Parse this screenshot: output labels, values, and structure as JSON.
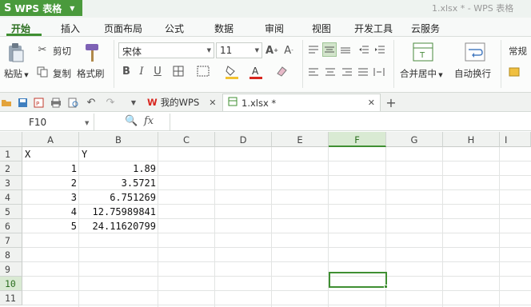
{
  "app": {
    "name": "WPS 表格",
    "logo": "S"
  },
  "window": {
    "title": "1.xlsx * - WPS 表格"
  },
  "ribbon_tabs": [
    "开始",
    "插入",
    "页面布局",
    "公式",
    "数据",
    "审阅",
    "视图",
    "开发工具",
    "云服务"
  ],
  "ribbon": {
    "paste": "粘贴",
    "cut": "剪切",
    "copy": "复制",
    "format_painter": "格式刷",
    "font_name": "宋体",
    "font_size": "11",
    "merge_center": "合并居中",
    "wrap_text": "自动换行",
    "normal": "常规"
  },
  "doc_tabs": {
    "home": "我的WPS",
    "file": "1.xlsx *"
  },
  "name_box": "F10",
  "formula_fx": "fx",
  "columns": [
    "A",
    "B",
    "C",
    "D",
    "E",
    "F",
    "G",
    "H",
    "I"
  ],
  "rows": [
    "1",
    "2",
    "3",
    "4",
    "5",
    "6",
    "7",
    "8",
    "9",
    "10",
    "11"
  ],
  "cells": {
    "A1": "X",
    "B1": "Y",
    "A2": "1",
    "B2": "1.89",
    "A3": "2",
    "B3": "3.5721",
    "A4": "3",
    "B4": "6.751269",
    "A5": "4",
    "B5": "12.75989841",
    "A6": "5",
    "B6": "24.11620799"
  },
  "selected_cell": "F10",
  "colors": {
    "accent": "#3f8f32",
    "app_green": "#4a9a3c",
    "selected_header": "#d9ead3"
  },
  "icons": [
    "paste-icon",
    "cut-icon",
    "copy-icon",
    "format-painter-icon",
    "bold-icon",
    "italic-icon",
    "underline-icon",
    "border-icon",
    "fill-color-icon",
    "font-color-icon",
    "merge-icon",
    "wrap-icon",
    "zoom-icon",
    "new-tab-icon",
    "close-icon"
  ]
}
